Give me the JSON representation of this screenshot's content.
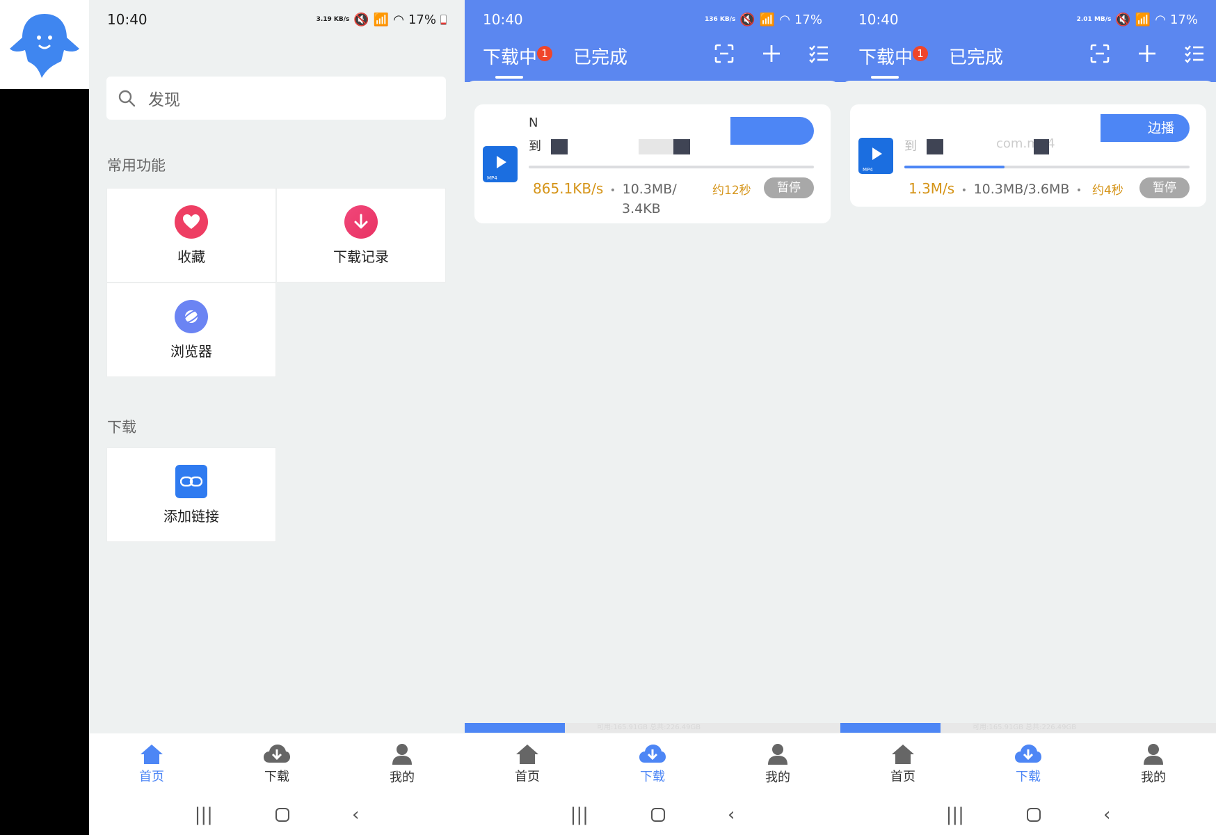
{
  "status": {
    "time": "10:40",
    "battery": "17%",
    "speeds": [
      "3.19 KB/s",
      "136 KB/s",
      "2.01 MB/s"
    ]
  },
  "home": {
    "search_placeholder": "发现",
    "section_common": "常用功能",
    "section_download": "下载",
    "tiles": {
      "favorites": "收藏",
      "download_history": "下载记录",
      "browser": "浏览器",
      "add_link": "添加链接"
    }
  },
  "nav": {
    "home": "首页",
    "download": "下载",
    "mine": "我的"
  },
  "downloads": {
    "tab_downloading": "下载中",
    "tab_badge": "1",
    "tab_completed": "已完成",
    "file_type": "MP4",
    "pause_label": "暂停",
    "play_while_download": "边播",
    "storage": "可用:165.91GB 总共:226.49GB",
    "task1": {
      "name_line1": "N",
      "name_line2": "到",
      "speed": "865.1KB/s",
      "size_line1": "10.3MB/",
      "size_line2": "3.4KB",
      "eta": "约12秒",
      "progress": 0.0
    },
    "task2": {
      "name_prefix": "到",
      "name_suffix": "com.mp4",
      "speed": "1.3M/s",
      "size": "10.3MB/3.6MB",
      "eta": "约4秒",
      "progress": 0.35
    }
  },
  "colors": {
    "accent": "#4d86f5",
    "header_blue": "#5b87f0",
    "speed_orange": "#d59418",
    "badge_red": "#f0452a"
  }
}
